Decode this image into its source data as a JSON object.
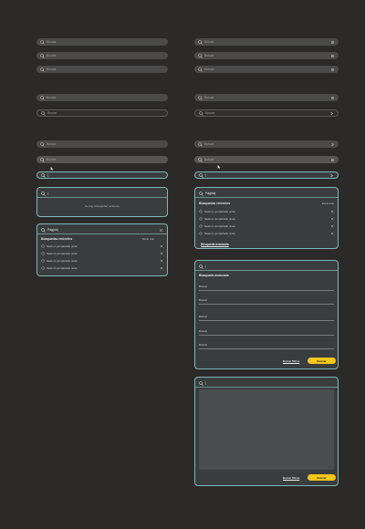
{
  "search": {
    "placeholder": "Buscar",
    "typing": "|"
  },
  "simple_panel": {
    "query": "|",
    "empty_message": "No hay búsquedas recientes"
  },
  "recent_panel_left": {
    "query": "Pág|na|",
    "section_title": "Búsquedas recientes",
    "clear_label": "Borrar todo",
    "items": [
      "Seek ut perspiciatis unde",
      "Seek ut perspiciatis unde",
      "Seek ut perspiciatis unde",
      "Seek ut perspiciatis unde"
    ]
  },
  "recent_panel_right": {
    "query": "Página|",
    "section_title": "Búsquedas recientes",
    "clear_label": "Borrar todo",
    "items": [
      "Seek ut perspiciatis unde",
      "Seek ut perspiciatis unde",
      "Seek ut perspiciatis unde",
      "Seek ut perspiciatis unde"
    ],
    "advanced_link": "Búsqueda avanzada"
  },
  "advanced_panel": {
    "title": "Búsqueda avanzada",
    "fields": [
      "Buscar",
      "Buscar",
      "Buscar",
      "Buscar",
      "Buscar"
    ],
    "clear_filters": "Borrar filtros",
    "submit": "Buscar"
  },
  "textarea_panel": {
    "query": "|",
    "clear_filters": "Borrar filtros",
    "submit": "Buscar"
  },
  "colors": {
    "accent": "#7fb5b8",
    "primary_button": "#f5c518",
    "background": "#2b2a28"
  },
  "icons": [
    "search-icon",
    "filter-icon",
    "collapse-icon",
    "close-icon",
    "history-icon",
    "cursor-icon"
  ]
}
